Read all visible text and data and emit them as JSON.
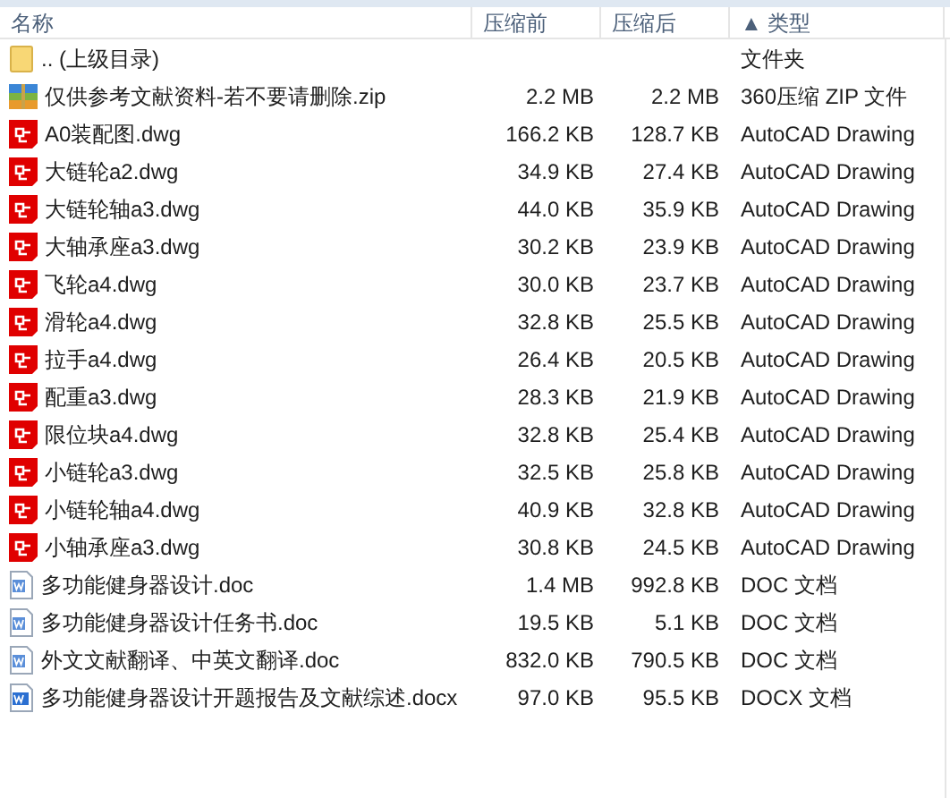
{
  "columns": [
    "名称",
    "压缩前",
    "压缩后",
    "▲ 类型"
  ],
  "rows": [
    {
      "kind": "folder",
      "name": ".. (上级目录)",
      "size": "",
      "packed": "",
      "type": "文件夹"
    },
    {
      "kind": "zip",
      "name": "仅供参考文献资料-若不要请删除.zip",
      "size": "2.2 MB",
      "packed": "2.2 MB",
      "type": "360压缩 ZIP 文件"
    },
    {
      "kind": "dwg",
      "name": "A0装配图.dwg",
      "size": "166.2 KB",
      "packed": "128.7 KB",
      "type": "AutoCAD Drawing"
    },
    {
      "kind": "dwg",
      "name": "大链轮a2.dwg",
      "size": "34.9 KB",
      "packed": "27.4 KB",
      "type": "AutoCAD Drawing"
    },
    {
      "kind": "dwg",
      "name": "大链轮轴a3.dwg",
      "size": "44.0 KB",
      "packed": "35.9 KB",
      "type": "AutoCAD Drawing"
    },
    {
      "kind": "dwg",
      "name": "大轴承座a3.dwg",
      "size": "30.2 KB",
      "packed": "23.9 KB",
      "type": "AutoCAD Drawing"
    },
    {
      "kind": "dwg",
      "name": "飞轮a4.dwg",
      "size": "30.0 KB",
      "packed": "23.7 KB",
      "type": "AutoCAD Drawing"
    },
    {
      "kind": "dwg",
      "name": "滑轮a4.dwg",
      "size": "32.8 KB",
      "packed": "25.5 KB",
      "type": "AutoCAD Drawing"
    },
    {
      "kind": "dwg",
      "name": "拉手a4.dwg",
      "size": "26.4 KB",
      "packed": "20.5 KB",
      "type": "AutoCAD Drawing"
    },
    {
      "kind": "dwg",
      "name": "配重a3.dwg",
      "size": "28.3 KB",
      "packed": "21.9 KB",
      "type": "AutoCAD Drawing"
    },
    {
      "kind": "dwg",
      "name": "限位块a4.dwg",
      "size": "32.8 KB",
      "packed": "25.4 KB",
      "type": "AutoCAD Drawing"
    },
    {
      "kind": "dwg",
      "name": "小链轮a3.dwg",
      "size": "32.5 KB",
      "packed": "25.8 KB",
      "type": "AutoCAD Drawing"
    },
    {
      "kind": "dwg",
      "name": "小链轮轴a4.dwg",
      "size": "40.9 KB",
      "packed": "32.8 KB",
      "type": "AutoCAD Drawing"
    },
    {
      "kind": "dwg",
      "name": "小轴承座a3.dwg",
      "size": "30.8 KB",
      "packed": "24.5 KB",
      "type": "AutoCAD Drawing"
    },
    {
      "kind": "doc",
      "name": "多功能健身器设计.doc",
      "size": "1.4 MB",
      "packed": "992.8 KB",
      "type": "DOC 文档"
    },
    {
      "kind": "doc",
      "name": "多功能健身器设计任务书.doc",
      "size": "19.5 KB",
      "packed": "5.1 KB",
      "type": "DOC 文档"
    },
    {
      "kind": "doc",
      "name": "外文文献翻译、中英文翻译.doc",
      "size": "832.0 KB",
      "packed": "790.5 KB",
      "type": "DOC 文档"
    },
    {
      "kind": "docx",
      "name": "多功能健身器设计开题报告及文献综述.docx",
      "size": "97.0 KB",
      "packed": "95.5 KB",
      "type": "DOCX 文档"
    }
  ]
}
